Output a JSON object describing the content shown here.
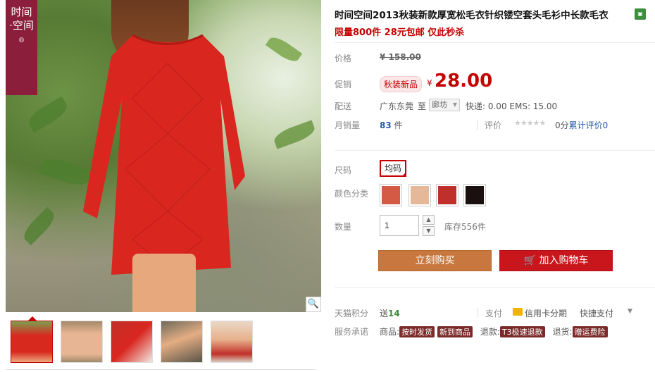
{
  "brand_logo": {
    "line1": "时间",
    "line2": "·空间",
    "mark": "®"
  },
  "product": {
    "title": "时间空间2013秋装新款厚宽松毛衣针织镂空套头毛衫中长款毛衣",
    "promo": "限量800件 28元包邮 仅此秒杀"
  },
  "price": {
    "label": "价格",
    "currency": "¥",
    "original": "158.00"
  },
  "sale": {
    "label": "促销",
    "badge": "秋装新品",
    "currency": "¥",
    "price": "28.00"
  },
  "shipping": {
    "label": "配送",
    "from": "广东东莞",
    "to_word": "至",
    "destination": "廊坊",
    "fee_text": "快递: 0.00 EMS: 15.00"
  },
  "sales": {
    "label": "月销量",
    "count": "83",
    "unit": "件",
    "rating_label": "评价",
    "stars": "★★★★★",
    "rating_score": "0分",
    "rating_total_label": "累计评价",
    "rating_total": "0"
  },
  "size": {
    "label": "尺码",
    "option": "均码"
  },
  "color": {
    "label": "颜色分类",
    "swatch_colors": [
      "#d45a45",
      "#e6b89a",
      "#c0302a",
      "#1a1010"
    ]
  },
  "quantity": {
    "label": "数量",
    "value": "1",
    "up": "▲",
    "down": "▼",
    "stock": "库存556件"
  },
  "actions": {
    "buy_now": "立刻购买",
    "add_cart": "加入购物车",
    "cart_icon": "🛒"
  },
  "points": {
    "label": "天猫积分",
    "prefix": "送",
    "value": "14"
  },
  "payment": {
    "label": "支付",
    "card": "信用卡分期",
    "fast": "快捷支付",
    "arrow": "▼"
  },
  "service": {
    "label": "服务承诺",
    "goods_label": "商品:",
    "goods_tags": [
      "按时发货",
      "新到商品"
    ],
    "return_label": "退款:",
    "return_tag": "T3极速退款",
    "exchange_label": "退货:",
    "exchange_tag": "赠运费险"
  },
  "zoom_icon": "🔍",
  "tmall_icon": "tmall"
}
